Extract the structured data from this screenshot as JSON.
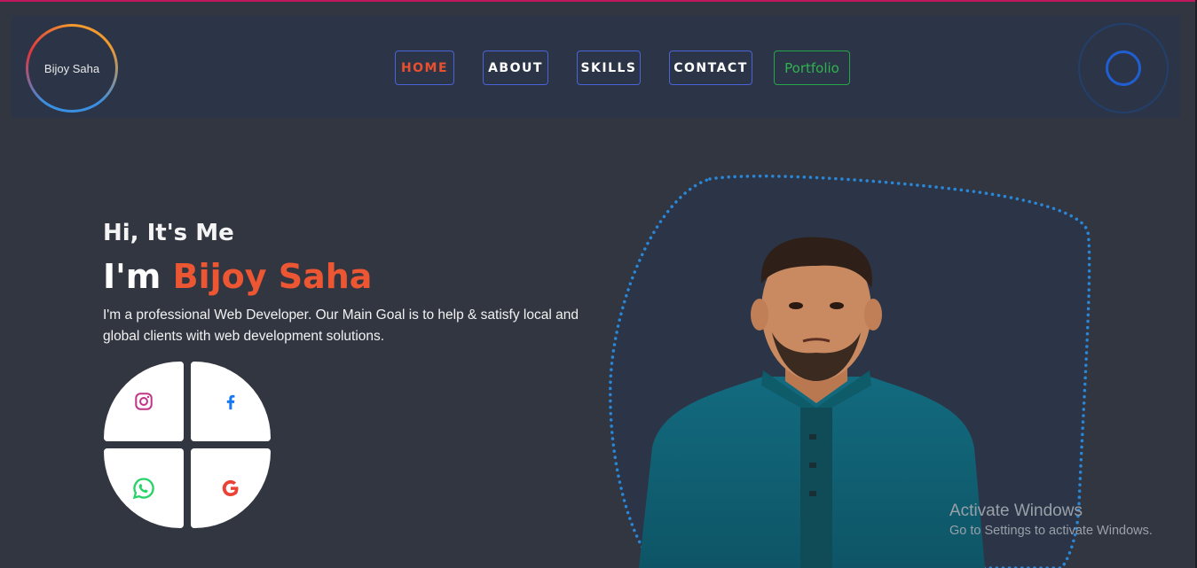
{
  "header": {
    "logo_text": "Bijoy Saha",
    "nav": [
      {
        "label": "HOME",
        "active": true
      },
      {
        "label": "ABOUT",
        "active": false
      },
      {
        "label": "SKILLS",
        "active": false
      },
      {
        "label": "CONTACT",
        "active": false
      }
    ],
    "portfolio_label": "Portfolio"
  },
  "hero": {
    "greeting": "Hi, It's Me",
    "name_prefix": "I'm ",
    "name": "Bijoy Saha",
    "description": "I'm a professional Web Developer. Our Main Goal is to help & satisfy local and global clients with web development solutions."
  },
  "social": [
    {
      "icon": "instagram-icon",
      "color": "#c13584"
    },
    {
      "icon": "facebook-icon",
      "color": "#1877f2"
    },
    {
      "icon": "whatsapp-icon",
      "color": "#25d366"
    },
    {
      "icon": "google-icon",
      "color": "#ea4335"
    }
  ],
  "colors": {
    "accent": "#ec5632",
    "background": "#323640",
    "navbar": "#2b3547",
    "nav_border": "#4a63d8",
    "portfolio_green": "#2fb34f",
    "blob_dots": "#2a86d6"
  },
  "watermark": {
    "line1": "Activate Windows",
    "line2": "Go to Settings to activate Windows."
  }
}
